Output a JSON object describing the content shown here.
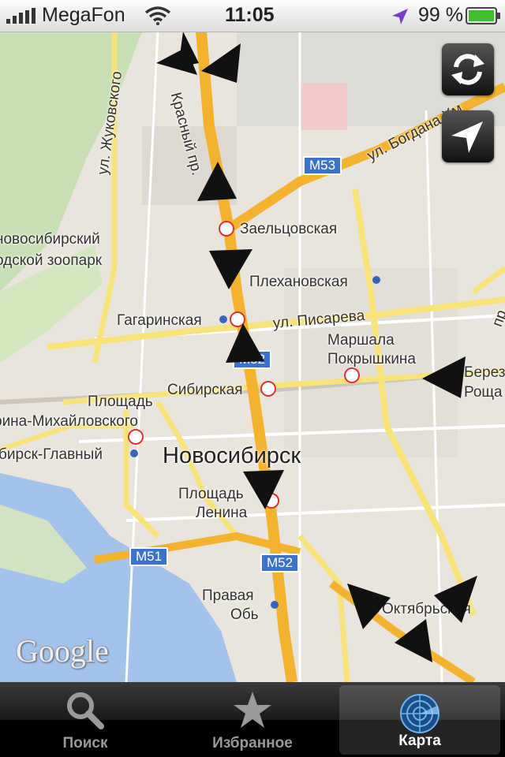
{
  "status_bar": {
    "carrier": "MegaFon",
    "time": "11:05",
    "battery": "99 %"
  },
  "map": {
    "city": "Новосибирск",
    "streets": [
      "ул. Жуковского",
      "Красный пр.",
      "ул. Богдана Хм",
      "ул. Писарева",
      "пр"
    ],
    "metro_stations": [
      "Заельцовская",
      "Гагаринская",
      "Сибирская",
      "Маршала",
      "Покрышкина",
      "Площадь",
      "Ленина",
      "Октябрьская"
    ],
    "labels": [
      "Плехановская",
      "новосибирский",
      "одской зоопарк",
      "Площадь",
      "рина-Михайловского",
      "бирск-Главный",
      "Правая",
      "Обь",
      "Берез",
      "Роща"
    ],
    "road_shields": [
      "M53",
      "M52",
      "M51",
      "M52"
    ],
    "attribution": "Google"
  },
  "map_buttons": {
    "refresh_icon": "refresh-icon",
    "locate_icon": "location-arrow-icon"
  },
  "tabs": [
    {
      "label": "Поиск",
      "icon": "search-icon",
      "selected": false
    },
    {
      "label": "Избранное",
      "icon": "star-icon",
      "selected": false
    },
    {
      "label": "Карта",
      "icon": "radar-icon",
      "selected": true
    }
  ]
}
